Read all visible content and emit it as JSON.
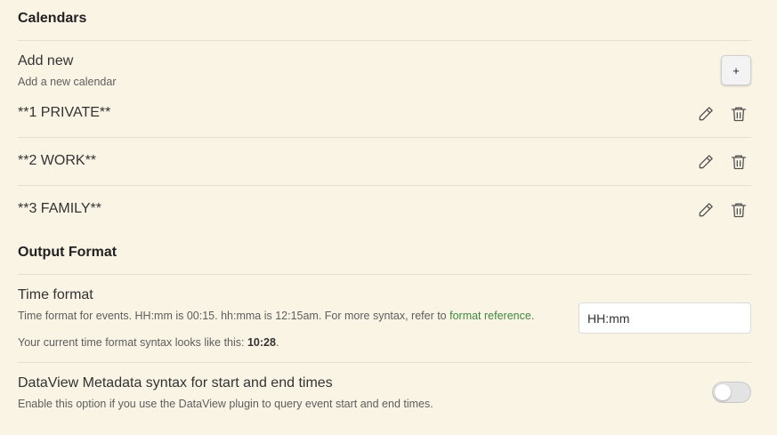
{
  "calendars_section": {
    "heading": "Calendars",
    "add_new": {
      "name": "Add new",
      "description": "Add a new calendar",
      "button_label": "+"
    },
    "items": [
      {
        "name": "**1 PRIVATE**",
        "edit_icon": "pencil-icon",
        "delete_icon": "trash-icon"
      },
      {
        "name": "**2 WORK**",
        "edit_icon": "pencil-icon",
        "delete_icon": "trash-icon"
      },
      {
        "name": "**3 FAMILY**",
        "edit_icon": "pencil-icon",
        "delete_icon": "trash-icon"
      }
    ]
  },
  "output_section": {
    "heading": "Output Format",
    "time_format": {
      "name": "Time format",
      "description_prefix": "Time format for events. HH:mm is 00:15. hh:mma is 12:15am. For more syntax, refer to ",
      "link_text": "format reference",
      "description_suffix": ".",
      "current_prefix": "Your current time format syntax looks like this: ",
      "current_value": "10:28",
      "current_suffix": ".",
      "input_value": "HH:mm"
    },
    "dataview": {
      "name": "DataView Metadata syntax for start and end times",
      "description": "Enable this option if you use the DataView plugin to query event start and end times.",
      "enabled": false
    }
  },
  "colors": {
    "background": "#faf4e5",
    "link": "#3d8b3d",
    "divider": "#e6dfcf"
  }
}
